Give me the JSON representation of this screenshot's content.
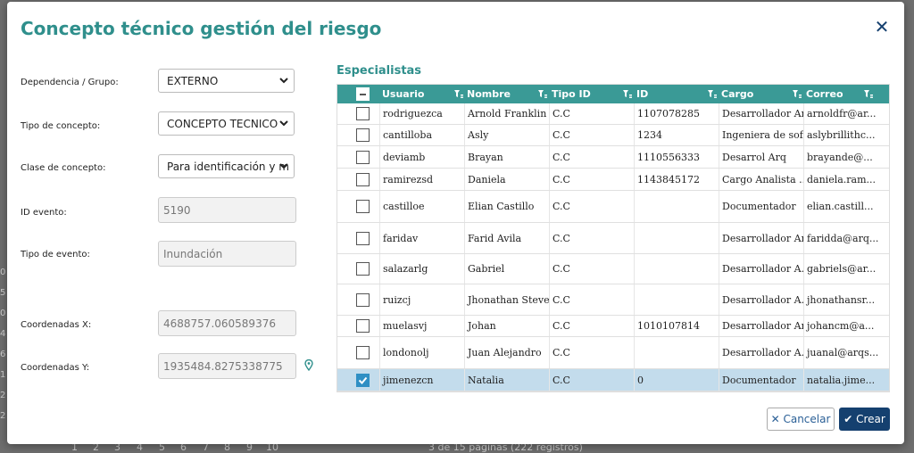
{
  "modal": {
    "title": "Concepto técnico gestión del riesgo",
    "close_icon": "close-icon"
  },
  "form": {
    "dependencia_label": "Dependencia / Grupo:",
    "dependencia_value": "EXTERNO",
    "tipo_concepto_label": "Tipo de concepto:",
    "tipo_concepto_value": "CONCEPTO TECNICO",
    "clase_concepto_label": "Clase de concepto:",
    "clase_concepto_value": "Para identificación y m",
    "id_evento_label": "ID evento:",
    "id_evento_value": "5190",
    "tipo_evento_label": "Tipo de evento:",
    "tipo_evento_value": "Inundación",
    "coord_x_label": "Coordenadas X:",
    "coord_x_value": "4688757.060589376",
    "coord_y_label": "Coordenadas Y:",
    "coord_y_value": "1935484.8275338775"
  },
  "specialists": {
    "title": "Especialistas",
    "columns": [
      "Usuario",
      "Nombre",
      "Tipo ID",
      "ID",
      "Cargo",
      "Correo"
    ],
    "rows": [
      {
        "checked": false,
        "usuario": "rodriguezca",
        "nombre": "Arnold Franklin",
        "tipo": "C.C",
        "id": "1107078285",
        "cargo": "Desarrollador Arq",
        "correo": "arnoldfr@ar..."
      },
      {
        "checked": false,
        "usuario": "cantilloba",
        "nombre": "Asly",
        "tipo": "C.C",
        "id": "1234",
        "cargo": "Ingeniera de sof...",
        "correo": "aslybrillithc..."
      },
      {
        "checked": false,
        "usuario": "deviamb",
        "nombre": "Brayan",
        "tipo": "C.C",
        "id": "1110556333",
        "cargo": "Desarrol Arq",
        "correo": "brayande@..."
      },
      {
        "checked": false,
        "usuario": "ramirezsd",
        "nombre": "Daniela",
        "tipo": "C.C",
        "id": "1143845172",
        "cargo": "Cargo Analista ...",
        "correo": "daniela.ram..."
      },
      {
        "checked": false,
        "usuario": "castilloe",
        "nombre": "Elian Castillo",
        "tipo": "C.C",
        "id": "",
        "cargo": "Documentador",
        "correo": "elian.castill..."
      },
      {
        "checked": false,
        "usuario": "faridav",
        "nombre": "Farid Avila",
        "tipo": "C.C",
        "id": "",
        "cargo": "Desarrollador Arq",
        "correo": "faridda@arq..."
      },
      {
        "checked": false,
        "usuario": "salazarlg",
        "nombre": "Gabriel",
        "tipo": "C.C",
        "id": "",
        "cargo": "Desarrollador A...",
        "correo": "gabriels@ar..."
      },
      {
        "checked": false,
        "usuario": "ruizcj",
        "nombre": "Jhonathan Steve",
        "tipo": "C.C",
        "id": "",
        "cargo": "Desarrollador A...",
        "correo": "jhonathansr..."
      },
      {
        "checked": false,
        "usuario": "muelasvj",
        "nombre": "Johan",
        "tipo": "C.C",
        "id": "1010107814",
        "cargo": "Desarrollador Arq",
        "correo": "johancm@a..."
      },
      {
        "checked": false,
        "usuario": "londonolj",
        "nombre": "Juan Alejandro",
        "tipo": "C.C",
        "id": "",
        "cargo": "Desarrollador A...",
        "correo": "juanal@arqs..."
      },
      {
        "checked": true,
        "usuario": "jimenezcn",
        "nombre": "Natalia",
        "tipo": "C.C",
        "id": "0",
        "cargo": "Documentador",
        "correo": "natalia.jime..."
      }
    ]
  },
  "buttons": {
    "cancel_label": "Cancelar",
    "create_label": "Crear"
  },
  "background": {
    "pager_pages": [
      "1",
      "2",
      "3",
      "4",
      "5",
      "6",
      "7",
      "8",
      "9",
      "10"
    ],
    "pager_info": "3 de 15 páginas (222 registros)",
    "side_digits": [
      "0",
      "5",
      "0",
      "4",
      "6",
      "1",
      "2",
      "2"
    ]
  },
  "colors": {
    "accent": "#2f8f8c",
    "header": "#3a9a96",
    "primary_button": "#15406f",
    "selected_row": "#c3dcec"
  }
}
